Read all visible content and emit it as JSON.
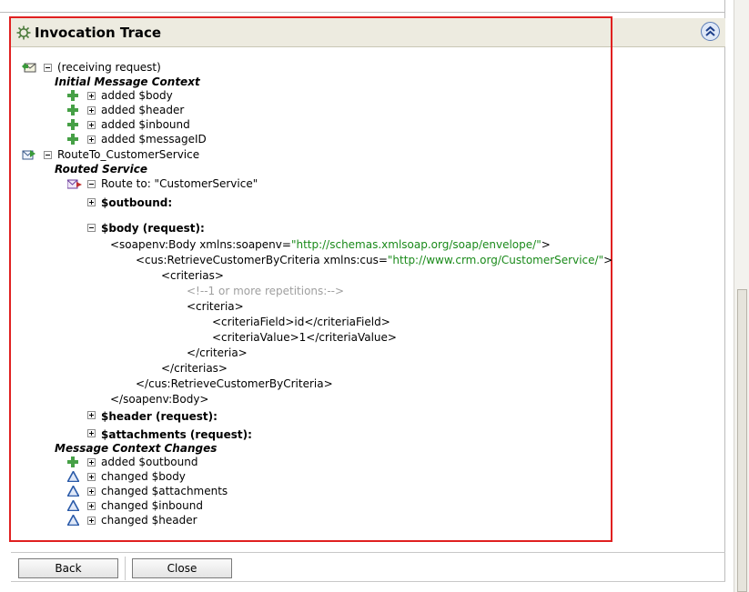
{
  "panel": {
    "title": "Invocation Trace"
  },
  "receiving": {
    "label": "(receiving request)",
    "section": "Initial Message Context",
    "items": [
      "added $body",
      "added $header",
      "added $inbound",
      "added $messageID"
    ]
  },
  "route": {
    "label": "RouteTo_CustomerService",
    "section": "Routed Service",
    "route_to": "Route to: \"CustomerService\"",
    "outbound": "$outbound:",
    "body": "$body  (request):",
    "header": "$header  (request):",
    "attachments": "$attachments  (request):"
  },
  "xml": {
    "line1_a": "<soapenv:Body xmlns:soapenv=",
    "line1_b": "\"http://schemas.xmlsoap.org/soap/envelope/\"",
    "line1_c": ">",
    "line2_a": "<cus:RetrieveCustomerByCriteria xmlns:cus=",
    "line2_b": "\"http://www.crm.org/CustomerService/\"",
    "line2_c": ">",
    "line3": "<criterias>",
    "line4": "<!--1 or more repetitions:-->",
    "line5": "<criteria>",
    "line6": "<criteriaField>id</criteriaField>",
    "line7": "<criteriaValue>1</criteriaValue>",
    "line8": "</criteria>",
    "line9": "</criterias>",
    "line10": "</cus:RetrieveCustomerByCriteria>",
    "line11": "</soapenv:Body>"
  },
  "changes": {
    "section": "Message Context Changes",
    "items": [
      "added $outbound",
      "changed $body",
      "changed $attachments",
      "changed $inbound",
      "changed $header"
    ]
  },
  "buttons": {
    "back": "Back",
    "close": "Close"
  },
  "colors": {
    "highlight_border": "#e02020",
    "header_bg": "#edebe0",
    "xml_string": "#1a8a1a",
    "xml_comment": "#a0a0a0",
    "added_icon": "#46a046",
    "changed_icon": "#2a5aa8"
  }
}
